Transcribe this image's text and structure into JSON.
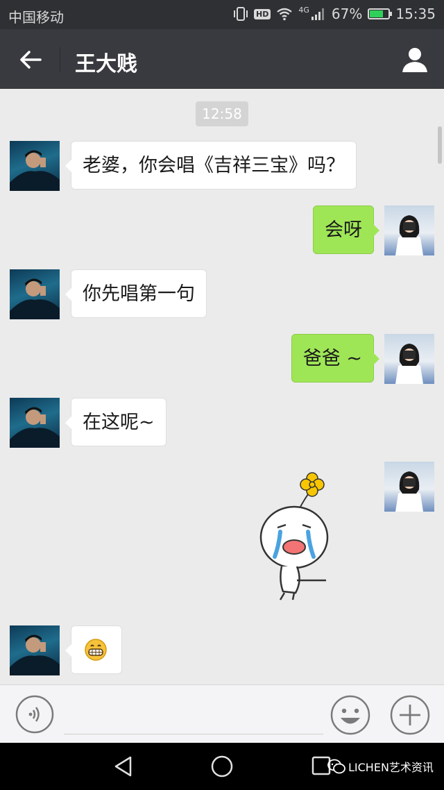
{
  "status_bar": {
    "carrier": "中国移动",
    "hd_badge": "HD",
    "network_badge": "4G",
    "battery": "67%",
    "battery_level": 0.67,
    "time": "15:35",
    "icons": [
      "vibrate-icon",
      "wifi-icon",
      "signal-icon",
      "battery-icon"
    ]
  },
  "header": {
    "title": "王大贱",
    "back_icon": "arrow-left-icon",
    "profile_icon": "person-icon"
  },
  "chat": {
    "timestamp": "12:58",
    "messages": [
      {
        "side": "in",
        "text": "老婆，你会唱《吉祥三宝》吗？"
      },
      {
        "side": "out",
        "text": "会呀"
      },
      {
        "side": "in",
        "text": "你先唱第一句"
      },
      {
        "side": "out",
        "text": "爸爸 ~"
      },
      {
        "side": "in",
        "text": "在这呢~"
      },
      {
        "side": "out",
        "type": "sticker",
        "sticker": "crying-doll-sticker"
      },
      {
        "side": "in",
        "type": "emoji",
        "emoji": "😬"
      }
    ]
  },
  "input_bar": {
    "placeholder": "",
    "icons": [
      "voice-icon",
      "emoji-icon",
      "plus-icon"
    ]
  },
  "nav_bar": {
    "icons": [
      "nav-back-icon",
      "nav-home-icon",
      "nav-recent-icon"
    ],
    "watermark": "LICHEN艺术资讯"
  },
  "colors": {
    "status_bar_bg": "#2e3033",
    "title_bar_bg": "#393a3f",
    "chat_bg": "#ebebeb",
    "outgoing_bubble": "#9fe657",
    "incoming_bubble": "#ffffff"
  }
}
